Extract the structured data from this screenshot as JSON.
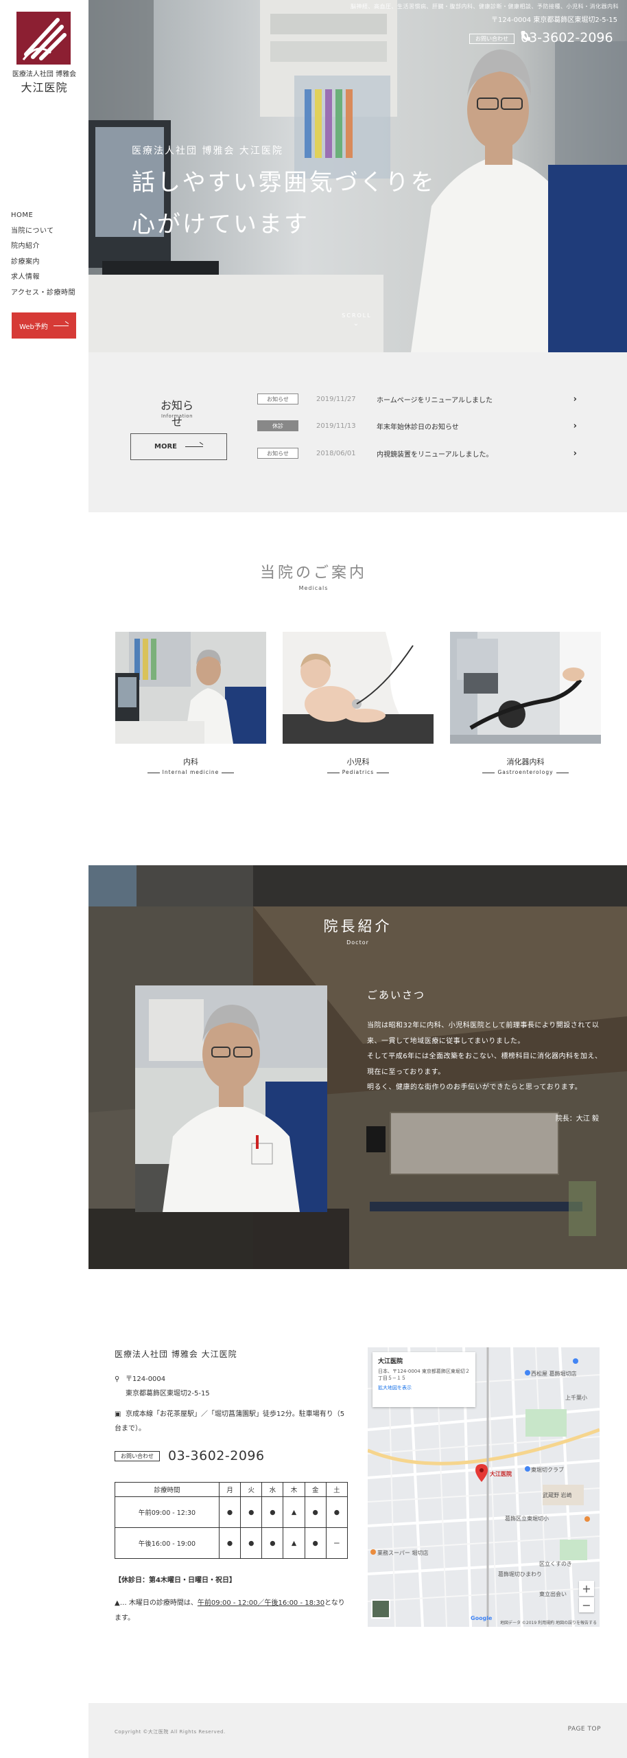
{
  "brand": {
    "sub": "医療法人社団 博雅会",
    "name": "大江医院"
  },
  "nav": [
    "HOME",
    "当院について",
    "院内紹介",
    "診療案内",
    "求人情報",
    "アクセス・診療時間"
  ],
  "web_reserve": "Web予約",
  "hero": {
    "top_line": "脳神経、高血圧、生活習慣病、肝臓・腹部内科、健康診断・健康相談、予防接種、小児科・消化器内科",
    "address": "〒124-0004 東京都葛飾区東堀切2-5-15",
    "contact_label": "お問い合わせ",
    "phone": "03-3602-2096",
    "sub": "医療法人社団 博雅会 大江医院",
    "heading_line1": "話しやすい雰囲気づくりを",
    "heading_line2": "心がけています",
    "scroll": "SCROLL"
  },
  "news": {
    "title": "お知らせ",
    "subtitle": "Information",
    "more": "MORE",
    "items": [
      {
        "badge": "お知らせ",
        "date": "2019/11/27",
        "title": "ホームページをリニューアルしました"
      },
      {
        "badge": "休診",
        "date": "2019/11/13",
        "title": "年末年始休診日のお知らせ"
      },
      {
        "badge": "お知らせ",
        "date": "2018/06/01",
        "title": "内視鏡装置をリニューアルしました。"
      }
    ]
  },
  "medicals": {
    "title": "当院のご案内",
    "subtitle": "Medicals",
    "items": [
      {
        "name": "内科",
        "en": "Internal medicine"
      },
      {
        "name": "小児科",
        "en": "Pediatrics"
      },
      {
        "name": "消化器内科",
        "en": "Gastroenterology"
      }
    ]
  },
  "doctor": {
    "title": "院長紹介",
    "subtitle": "Doctor",
    "greeting_title": "ごあいさつ",
    "greeting": [
      "当院は昭和32年に内科、小児科医院として前理事長により開設されて以来、一貫して地域医療に従事してまいりました。",
      "そして平成6年には全面改築をおこない、標榜科目に消化器内科を加え、現在に至っております。",
      "明るく、健康的な街作りのお手伝いができたらと思っております。"
    ],
    "sign": "院長：大江 毅"
  },
  "access": {
    "name": "医療法人社団 博雅会 大江医院",
    "zip": "〒124-0004",
    "address": "東京都葛飾区東堀切2-5-15",
    "train": "京成本線「お花茶屋駅」／「堀切菖蒲園駅」徒歩12分。駐車場有り（5台まで）。",
    "contact_label": "お問い合わせ",
    "phone": "03-3602-2096",
    "hours": {
      "header": [
        "診療時間",
        "月",
        "火",
        "水",
        "木",
        "金",
        "土"
      ],
      "rows": [
        [
          "午前09:00 - 12:30",
          "●",
          "●",
          "●",
          "▲",
          "●",
          "●"
        ],
        [
          "午後16:00 - 19:00",
          "●",
          "●",
          "●",
          "▲",
          "●",
          "ー"
        ]
      ]
    },
    "closed": "【休診日：第4木曜日・日曜日・祝日】",
    "note_pre": "▲… 木曜日の診療時間は、",
    "note_link": "午前09:00 - 12:00／午後16:00 - 18:30",
    "note_post": "となります。"
  },
  "map": {
    "card_name": "大江医院",
    "card_addr": "日本、〒124-0004 東京都葛飾区東堀切２丁目５−１５",
    "card_link": "拡大地図を表示",
    "pin_label": "大江医院",
    "labels": [
      "西松屋 葛飾堀切店",
      "東堀切クラブ",
      "上千葉小",
      "葛飾区立東堀切小",
      "業務スーパー 堀切店",
      "武蔵野 岩崎",
      "区立くすのき",
      "葛飾堀切ひまわり",
      "東立出会い"
    ],
    "footer": "地図データ ©2019 利用規約 地図の誤りを報告する",
    "google": "Google"
  },
  "footer": {
    "copy": "Copyright ©大江医院 All Rights Reserved.",
    "pagetop": "PAGE TOP"
  },
  "colors": {
    "brand": "#8c1f32",
    "accent": "#d63a36",
    "gray_bg": "#f0f0f0"
  }
}
